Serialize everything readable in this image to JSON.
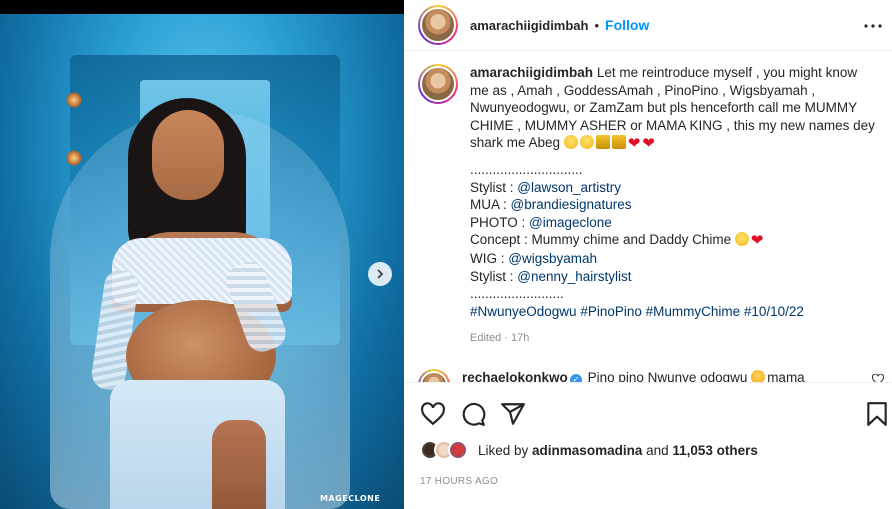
{
  "post": {
    "username": "amarachiigidimbah",
    "follow_label": "Follow",
    "separator": "•",
    "more_label": "•••",
    "watermark": "MAGECLONE",
    "next_icon": "chevron-right-icon"
  },
  "caption": {
    "username": "amarachiigidimbah",
    "text": "Let me reintroduce myself , you might know me as , Amah , GoddessAmah , PinoPino , Wigsbyamah , Nwunyeodogwu, or ZamZam but pls henceforth call me MUMMY CHIME , MUMMY ASHER or MAMA KING , this my new names dey shark me Abeg",
    "dots1": "..............................",
    "credits": [
      {
        "label": "Stylist : ",
        "handle": "@lawson_artistry"
      },
      {
        "label": "MUA : ",
        "handle": "@brandiesignatures"
      },
      {
        "label": "PHOTO : ",
        "handle": "@imageclone"
      }
    ],
    "concept": "Concept : Mummy chime and Daddy Chime",
    "credits2": [
      {
        "label": "WIG : ",
        "handle": "@wigsbyamah"
      },
      {
        "label": "Stylist : ",
        "handle": "@nenny_hairstylist"
      }
    ],
    "dots2": ".........................",
    "hashtags": "#NwunyeOdogwu #PinoPino #MummyChime #10/10/22",
    "meta": "Edited · 17h"
  },
  "comment": {
    "username": "rechaelokonkwo",
    "text": "Pino pino Nwunye odogwu",
    "text_after": "mama"
  },
  "likes": {
    "prefix": "Liked by ",
    "user": "adinmasomadina",
    "mid": " and ",
    "count": "11,053 others"
  },
  "timestamp": "17 HOURS AGO",
  "colors": {
    "link": "#00376b",
    "follow": "#0095f6",
    "muted": "#8e8e8e",
    "heart": "#e0102b"
  }
}
